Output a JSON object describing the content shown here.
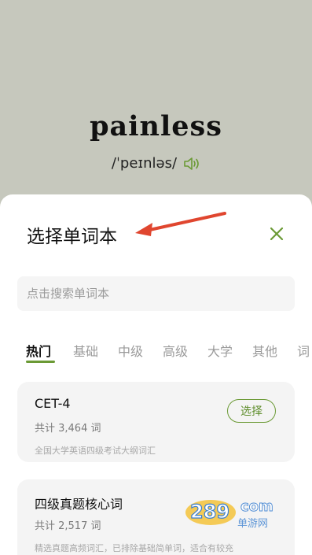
{
  "hero": {
    "word": "painless",
    "phonetic": "/ˈpeɪnləs/",
    "speaker_icon": "speaker-icon"
  },
  "sheet": {
    "title": "选择单词本",
    "close_icon": "close-icon",
    "search": {
      "placeholder": "点击搜索单词本",
      "value": ""
    },
    "tabs": [
      {
        "label": "热门",
        "active": true
      },
      {
        "label": "基础",
        "active": false
      },
      {
        "label": "中级",
        "active": false
      },
      {
        "label": "高级",
        "active": false
      },
      {
        "label": "大学",
        "active": false
      },
      {
        "label": "其他",
        "active": false
      },
      {
        "label": "词",
        "active": false
      }
    ],
    "books": [
      {
        "title": "CET-4",
        "count": "共计 3,464 词",
        "desc": "全国大学英语四级考试大纲词汇",
        "action": "选择"
      },
      {
        "title": "四级真题核心词",
        "count": "共计 2,517 词",
        "desc": "精选真题高频词汇，已排除基础简单词，适合有较充"
      }
    ]
  },
  "watermark": {
    "brand": "289",
    "suffix": "com",
    "tagline": "单游网"
  },
  "colors": {
    "accent": "#6b9a35",
    "background": "#c6c8bd",
    "arrow": "#e0462f"
  }
}
